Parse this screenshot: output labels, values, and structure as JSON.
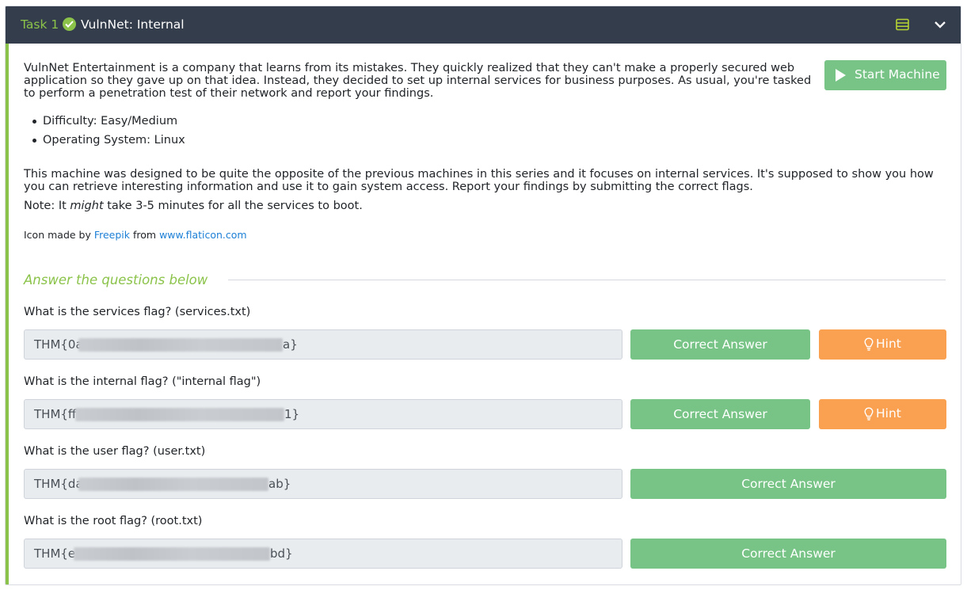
{
  "task": {
    "label": "Task 1",
    "title": "VulnNet: Internal"
  },
  "intro": "VulnNet Entertainment is a company that learns from its mistakes. They quickly realized that they can't make a properly secured web application so they gave up on that idea. Instead, they decided to set up internal services for business purposes. As usual, you're tasked to perform a penetration test of their network and report your findings.",
  "start_machine_label": "Start Machine",
  "bullets": [
    "Difficulty: Easy/Medium",
    "Operating System: Linux"
  ],
  "description": "This machine was designed to be quite the opposite of the previous machines in this series and it focuses on internal services. It's supposed to show you how you can retrieve interesting information and use it to gain system access. Report your findings by submitting the correct flags.",
  "note": {
    "prefix": "Note: It ",
    "emphasis": "might",
    "suffix": " take 3-5 minutes for all the services to boot."
  },
  "credit": {
    "prefix": "Icon made by ",
    "author": "Freepik",
    "middle": " from ",
    "site": "www.flaticon.com"
  },
  "section_title": "Answer the questions below",
  "questions": [
    {
      "label": "What is the services flag? (services.txt)",
      "answer_start": "THM{0a",
      "answer_end": "a}",
      "button": "Correct Answer",
      "hint": "Hint"
    },
    {
      "label": "What is the internal flag? (\"internal flag\")",
      "answer_start": "THM{ff",
      "answer_end": "1}",
      "button": "Correct Answer",
      "hint": "Hint"
    },
    {
      "label": "What is the user flag? (user.txt)",
      "answer_start": "THM{da",
      "answer_end": "ab}",
      "button": "Correct Answer"
    },
    {
      "label": "What is the root flag? (root.txt)",
      "answer_start": "THM{e",
      "answer_end": "bd}",
      "button": "Correct Answer"
    }
  ],
  "colors": {
    "header_bg": "#343d4b",
    "accent_green": "#8bc34a",
    "button_green": "#77c486",
    "hint_orange": "#f9a051",
    "link_blue": "#1c7fd6"
  },
  "icons": [
    "check-circle-icon",
    "list-icon",
    "chevron-down-icon",
    "play-icon",
    "lightbulb-icon"
  ]
}
